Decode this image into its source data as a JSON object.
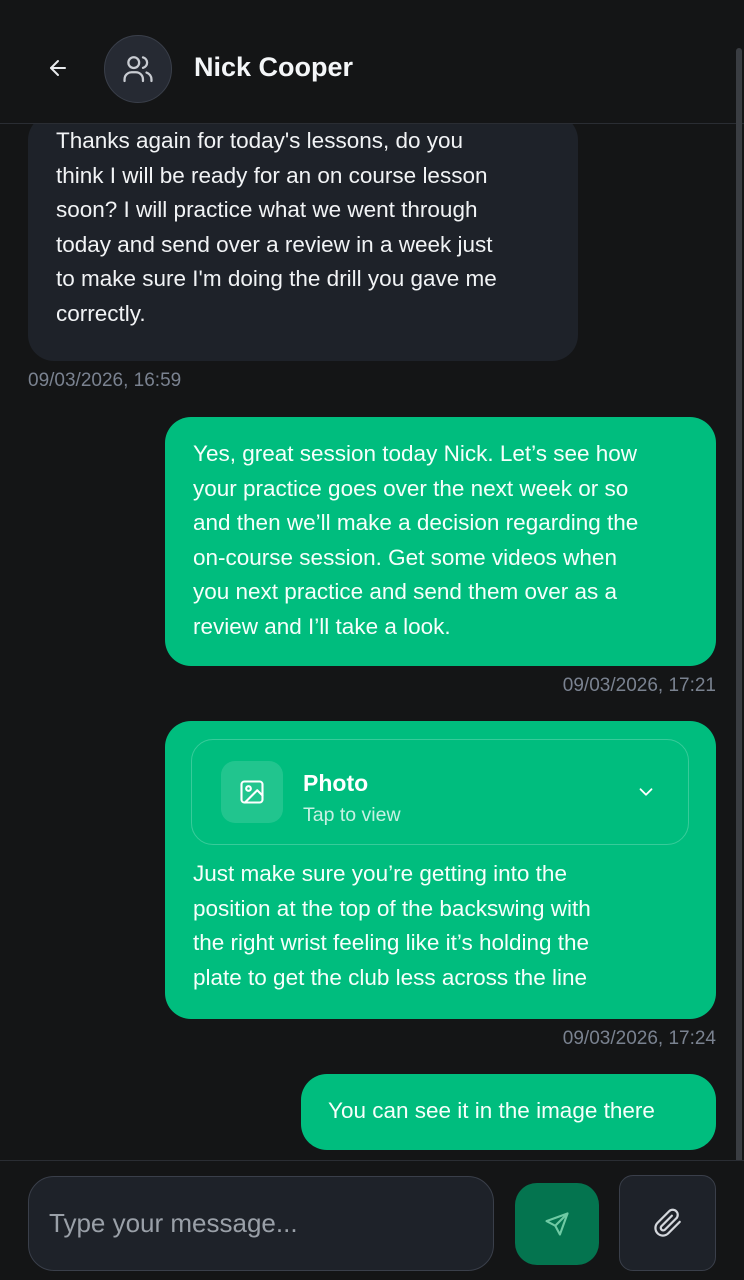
{
  "header": {
    "contact_name": "Nick Cooper",
    "back_icon": "arrow-left-icon",
    "avatar_icon": "users-icon"
  },
  "messages": [
    {
      "direction": "incoming",
      "text": "Thanks again for today's lessons, do you think I will be ready for an on course lesson soon? I will practice what we went through today and send over a review in a week just to make sure I'm doing the drill you gave me correctly.",
      "lines": [
        "Thanks again for today's lessons, do you",
        "think I will be ready for an on course lesson",
        "soon? I will practice what we went through",
        "today and send over a review in a week just",
        "to make sure I'm doing the drill you gave me",
        "correctly."
      ],
      "timestamp": "09/03/2026, 16:59"
    },
    {
      "direction": "outgoing",
      "text": "Yes, great session today Nick. Let’s see how your practice goes over the next week or so and then we’ll make a decision regarding the on-course session. Get some videos when you next practice and send them over as a review and I’ll take a look.",
      "lines": [
        "Yes, great session today Nick. Let’s see how",
        "your practice goes over the next week or so",
        "and then we’ll make a decision regarding the",
        "on-course session. Get some videos when",
        "you next practice and send them over as a",
        "review and I’ll take a look."
      ],
      "timestamp": "09/03/2026, 17:21"
    },
    {
      "direction": "outgoing",
      "attachment": {
        "title": "Photo",
        "subtitle": "Tap to view",
        "icon": "image-icon",
        "chevron_icon": "chevron-down-icon"
      },
      "text": "Just make sure you’re getting into the position at the top of the backswing with the right wrist feeling like it’s holding the plate to get the club less across the line",
      "lines": [
        "Just make sure you’re getting into the",
        "position at the top of the backswing with",
        "the right wrist feeling like it’s holding the",
        "plate to get the club less across the line"
      ],
      "timestamp": "09/03/2026, 17:24"
    },
    {
      "direction": "outgoing",
      "text": "You can see it in the image there",
      "lines": [
        "You can see it in the image there"
      ]
    }
  ],
  "composer": {
    "placeholder": "Type your message...",
    "value": "",
    "send_icon": "send-icon",
    "attach_icon": "paperclip-icon"
  },
  "colors": {
    "background": "#141516",
    "incoming_bubble": "#1e2229",
    "outgoing_bubble": "#00bd7e",
    "send_button": "#04744f",
    "timestamp": "#7a8290"
  }
}
